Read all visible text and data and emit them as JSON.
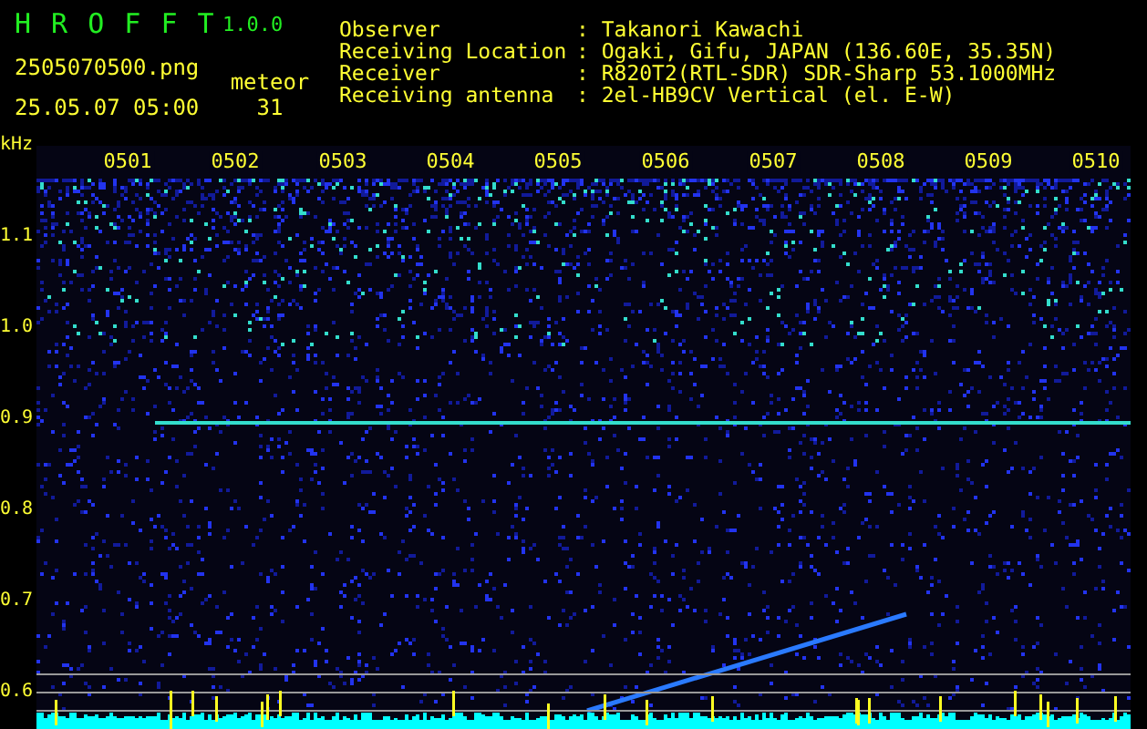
{
  "header": {
    "title": "H R O F F T",
    "version": "1.0.0",
    "filename": "2505070500.png",
    "datetime": "25.05.07 05:00",
    "count_label": "meteor",
    "count": "31"
  },
  "info": [
    {
      "label": "Observer",
      "value": ": Takanori Kawachi"
    },
    {
      "label": "Receiving Location",
      "value": ": Ogaki, Gifu, JAPAN (136.60E, 35.35N)"
    },
    {
      "label": "Receiver",
      "value": ": R820T2(RTL-SDR) SDR-Sharp 53.1000MHz"
    },
    {
      "label": "Receiving antenna",
      "value": ": 2el-HB9CV Vertical (el. E-W)"
    }
  ],
  "axis": {
    "unit": "kHz",
    "y_labels": [
      "1.1",
      "1.0",
      "0.9",
      "0.8",
      "0.7",
      "0.6"
    ],
    "x_labels": [
      "0501",
      "0502",
      "0503",
      "0504",
      "0505",
      "0506",
      "0507",
      "0508",
      "0509",
      "0510"
    ]
  }
}
